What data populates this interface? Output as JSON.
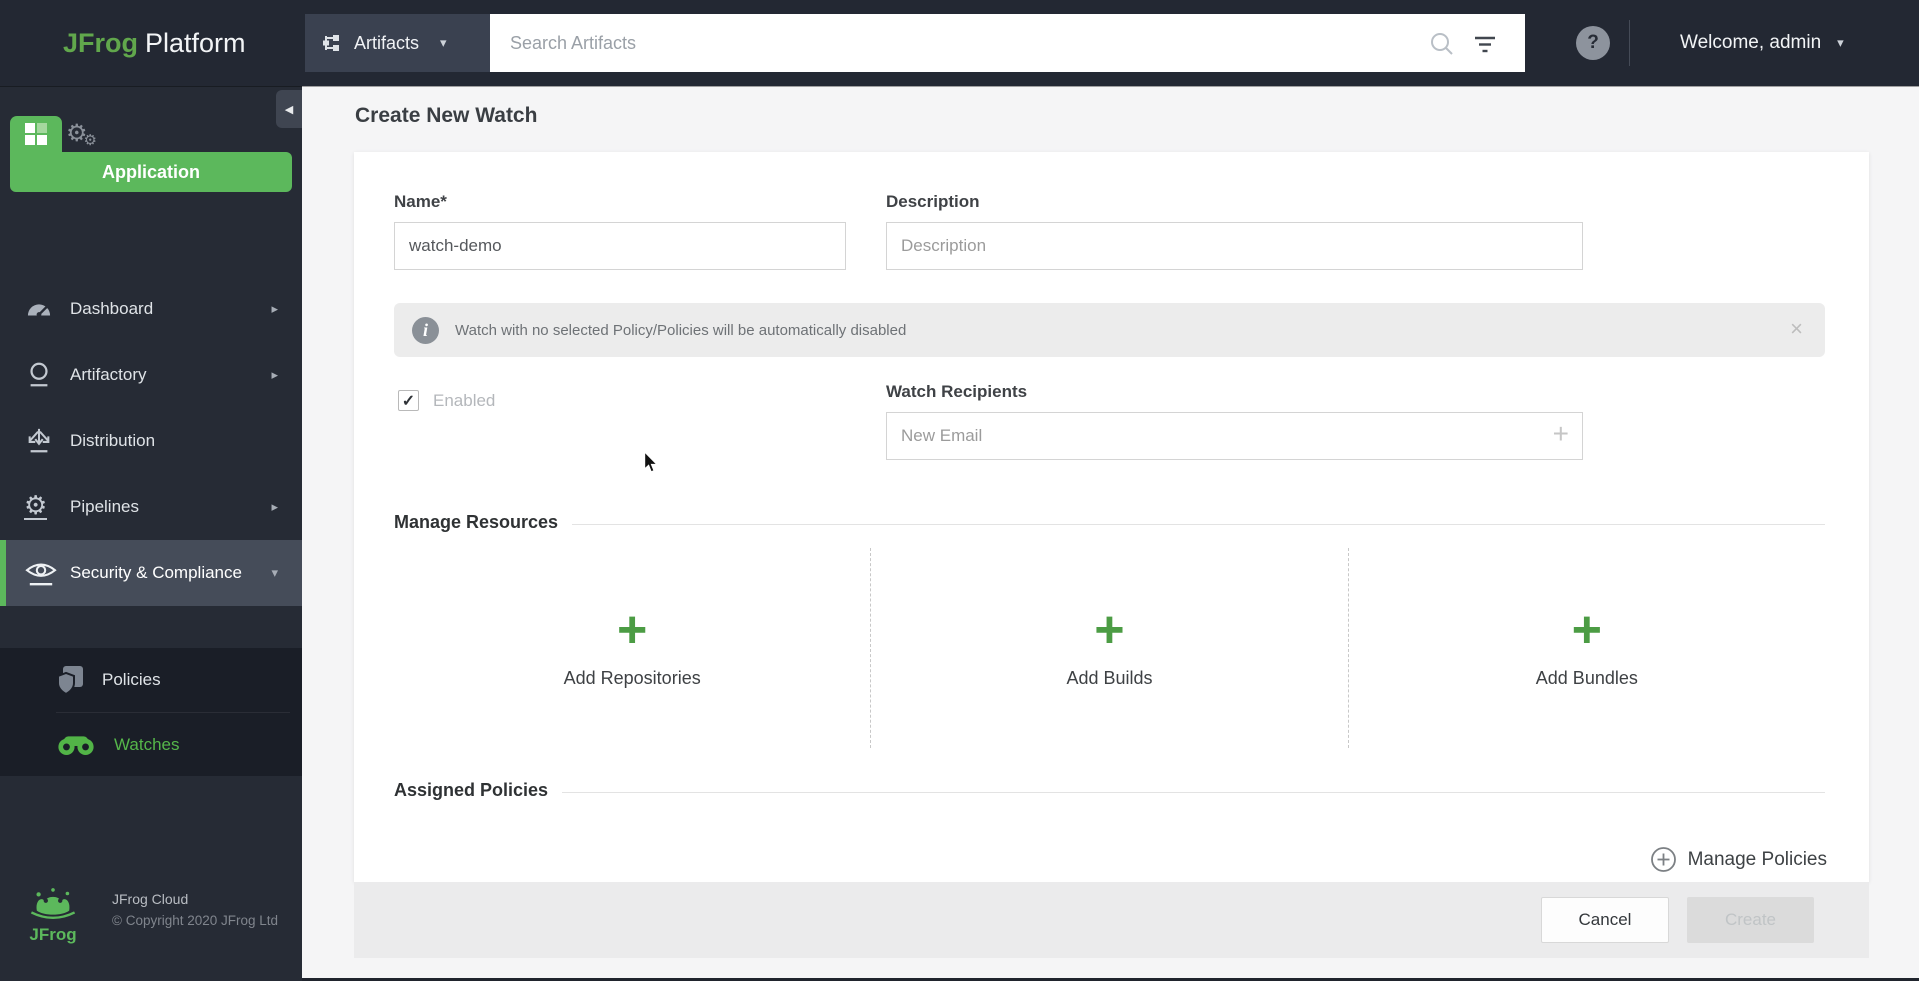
{
  "topbar": {
    "logo_primary": "JFrog",
    "logo_secondary": "Platform",
    "context_switcher_label": "Artifacts",
    "search_placeholder": "Search Artifacts",
    "help_glyph": "?",
    "user_menu_label": "Welcome, admin"
  },
  "sidebar": {
    "application_banner": "Application",
    "items": [
      {
        "label": "Dashboard"
      },
      {
        "label": "Artifactory"
      },
      {
        "label": "Distribution"
      },
      {
        "label": "Pipelines"
      },
      {
        "label": "Security & Compliance"
      }
    ],
    "submenu": [
      {
        "label": "Policies"
      },
      {
        "label": "Watches"
      }
    ],
    "footer": {
      "logo_text": "JFrog",
      "product": "JFrog Cloud",
      "copyright": "© Copyright 2020 JFrog Ltd"
    }
  },
  "main": {
    "page_title": "Create New Watch",
    "form": {
      "name_label": "Name*",
      "name_value": "watch-demo",
      "description_label": "Description",
      "description_placeholder": "Description",
      "info_message": "Watch with no selected Policy/Policies will be automatically disabled",
      "enabled_label": "Enabled",
      "enabled_checked": true,
      "recipients_label": "Watch Recipients",
      "recipients_placeholder": "New Email"
    },
    "sections": {
      "manage_resources": "Manage Resources",
      "assigned_policies": "Assigned Policies"
    },
    "resource_actions": [
      {
        "label": "Add Repositories"
      },
      {
        "label": "Add Builds"
      },
      {
        "label": "Add Bundles"
      }
    ],
    "manage_policies_label": "Manage Policies",
    "footer_buttons": {
      "cancel": "Cancel",
      "create": "Create"
    }
  },
  "icons": {
    "caret_down": "▾",
    "caret_right": "▸",
    "collapse_left": "◀",
    "close": "×",
    "plus": "+",
    "question": "?",
    "info": "i",
    "check": "✓",
    "gear": "⚙"
  },
  "colors": {
    "accent_green": "#5cb85c",
    "topbar_bg": "#232833",
    "sidebar_bg": "#262b35",
    "submenu_bg": "#1a1e27",
    "selected_row_bg": "#454c59",
    "page_bg": "#f5f5f6",
    "banner_bg": "#ececec",
    "footer_band_bg": "#ebebec"
  }
}
